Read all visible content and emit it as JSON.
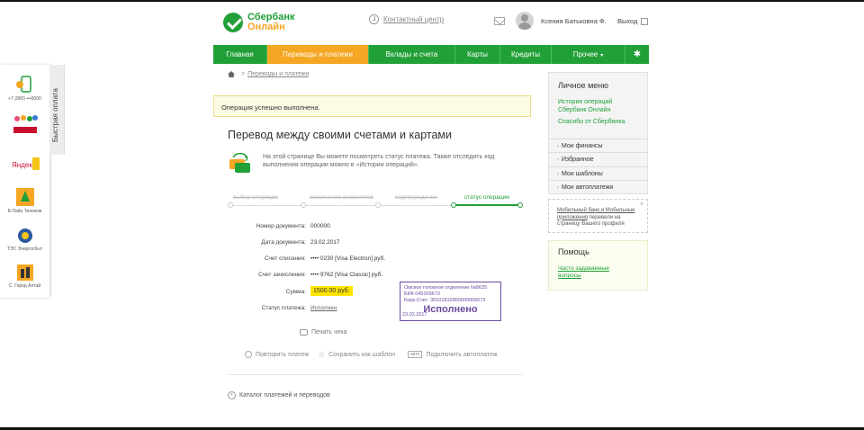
{
  "header": {
    "logo_line1": "Сбербанк",
    "logo_line2": "Онлайн",
    "contact_center": "Контактный центр",
    "user_name": "Ксения Батьковна Ф.",
    "logout": "Выход"
  },
  "nav": {
    "items": [
      {
        "label": "Главная",
        "active": false
      },
      {
        "label": "Переводы и платежи",
        "active": true
      },
      {
        "label": "Вклады и счета",
        "active": false
      },
      {
        "label": "Карты",
        "active": false
      },
      {
        "label": "Кредиты",
        "active": false
      },
      {
        "label": "Прочее",
        "active": false
      }
    ]
  },
  "breadcrumb": {
    "separator": ">",
    "link": "Переводы и платежи"
  },
  "alert": {
    "text": "Операция успешно выполнена."
  },
  "page": {
    "title": "Перевод между своими счетами и картами",
    "info_text": "На этой странице Вы можете посмотреть статус платежа. Также отследить ход выполнения операции можно в «Истории операций»."
  },
  "steps": [
    {
      "label": "выбор операции",
      "active": false
    },
    {
      "label": "заполнение реквизитов",
      "active": false
    },
    {
      "label": "подтверждение",
      "active": false
    },
    {
      "label": "статус операции",
      "active": true
    }
  ],
  "details": {
    "doc_number_label": "Номер документа:",
    "doc_number_value": "000000",
    "doc_date_label": "Дата документа:",
    "doc_date_value": "23.02.2017",
    "debit_label": "Счет списания:",
    "debit_value": "•••• 0230  [Visa Electron]    руб.",
    "credit_label": "Счет зачисления:",
    "credit_value": "•••• 9762  [Visa Classic]    руб.",
    "amount_label": "Сумма:",
    "amount_value": "1500.00 руб.",
    "status_label": "Статус платежа:",
    "status_value": "Исполнен"
  },
  "stamp": {
    "line1": "Омское головное отделение №8635",
    "line2": "БИК 045209673",
    "line3": "Корр.Счет: 30101810900000000673",
    "status": "Исполнено",
    "date": "23.02.2017"
  },
  "actions": {
    "print": "Печать чека",
    "repeat": "Повторить платеж",
    "save_template": "Сохранить как шаблон",
    "auto_badge": "авто",
    "autopay": "Подключить автоплатеж"
  },
  "catalog": {
    "text": "Каталог платежей и переводов"
  },
  "personal_menu": {
    "title": "Личное меню",
    "links": [
      "История операций",
      "Сбербанк Онлайн",
      "Спасибо от Сбербанка"
    ],
    "items": [
      "Мои финансы",
      "Избранное",
      "Мои шаблоны",
      "Мои автоплатежи"
    ]
  },
  "promo": {
    "link": "Мобильный банк и Мобильные приложения",
    "text": "перевели на страницу Вашего профиля",
    "close": "×"
  },
  "help": {
    "title": "Помощь",
    "link_line1": "Часто задаваемые",
    "link_line2": "вопросы"
  },
  "quick_pay": {
    "tab_label": "Быстрая оплата",
    "items": [
      {
        "label": "+7 (900) •••0000"
      },
      {
        "label": ""
      },
      {
        "label": ""
      },
      {
        "label": "Б-Лайн Телеком"
      },
      {
        "label": "ТЭС Энергосбыт"
      },
      {
        "label": "С. Город Алтай"
      }
    ]
  },
  "colors": {
    "brand_green": "#21a038",
    "brand_orange": "#f5a623",
    "stamp_purple": "#6b4aa0",
    "amount_highlight": "#ffe600"
  }
}
